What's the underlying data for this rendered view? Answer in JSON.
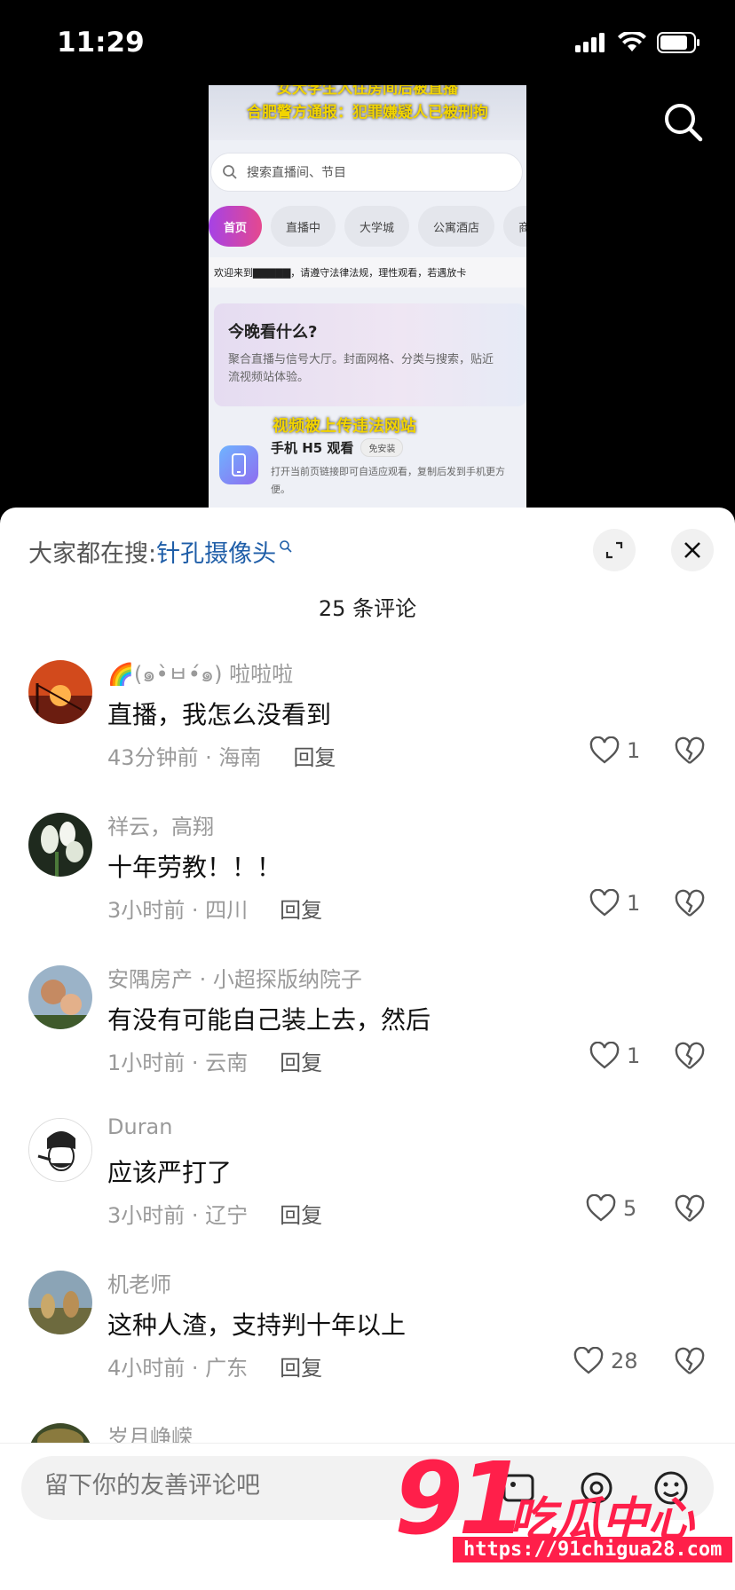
{
  "status_bar": {
    "time": "11:29"
  },
  "video": {
    "headline_line1": "女大学生入住房间后被直播",
    "headline_line2": "合肥警方通报：犯罪嫌疑人已被刑拘",
    "search_placeholder": "搜索直播间、节目",
    "tabs": [
      "首页",
      "直播中",
      "大学城",
      "公寓酒店",
      "商业"
    ],
    "welcome_text": "欢迎来到▇▇▇▇▇，请遵守法律法规，理性观看，若遇放卡",
    "card_title": "今晚看什么?",
    "card_desc_line1": "聚合直播与信号大厅。封面网格、分类与搜索，贴近",
    "card_desc_line2": "流视频站体验。",
    "overlay_caption": "视频被上传违法网站",
    "h5_title": "手机 H5 观看",
    "h5_badge": "免安装",
    "h5_desc": "打开当前页链接即可自适应观看，复制后发到手机更方便。"
  },
  "sheet": {
    "search_prefix": "大家都在搜:",
    "search_term": "针孔摄像头",
    "comment_count": "25 条评论"
  },
  "comments": [
    {
      "name": "🌈(๑•̀ㅂ•́๑) 啦啦啦",
      "text": "直播，我怎么没看到",
      "time": "43分钟前 · 海南",
      "reply": "回复",
      "likes": "1"
    },
    {
      "name": "祥云，高翔",
      "text": "十年劳教！！！",
      "time": "3小时前 · 四川",
      "reply": "回复",
      "likes": "1"
    },
    {
      "name": "安隅房产 · 小超探版纳院子",
      "text": "有没有可能自己装上去，然后",
      "time": "1小时前 · 云南",
      "reply": "回复",
      "likes": "1"
    },
    {
      "name": "Duran",
      "text": "应该严打了",
      "time": "3小时前 · 辽宁",
      "reply": "回复",
      "likes": "5"
    },
    {
      "name": "机老师",
      "text": "这种人渣，支持判十年以上",
      "time": "4小时前 · 广东",
      "reply": "回复",
      "likes": "28"
    },
    {
      "name": "岁月峥嵘"
    }
  ],
  "input_bar": {
    "placeholder": "留下你的友善评论吧"
  },
  "watermark": {
    "number": "91",
    "text": "吃瓜中心",
    "url": "https://91chigua28.com"
  },
  "colors": {
    "accent_link": "#1f5ea8",
    "watermark_red": "#ff1f4a"
  }
}
